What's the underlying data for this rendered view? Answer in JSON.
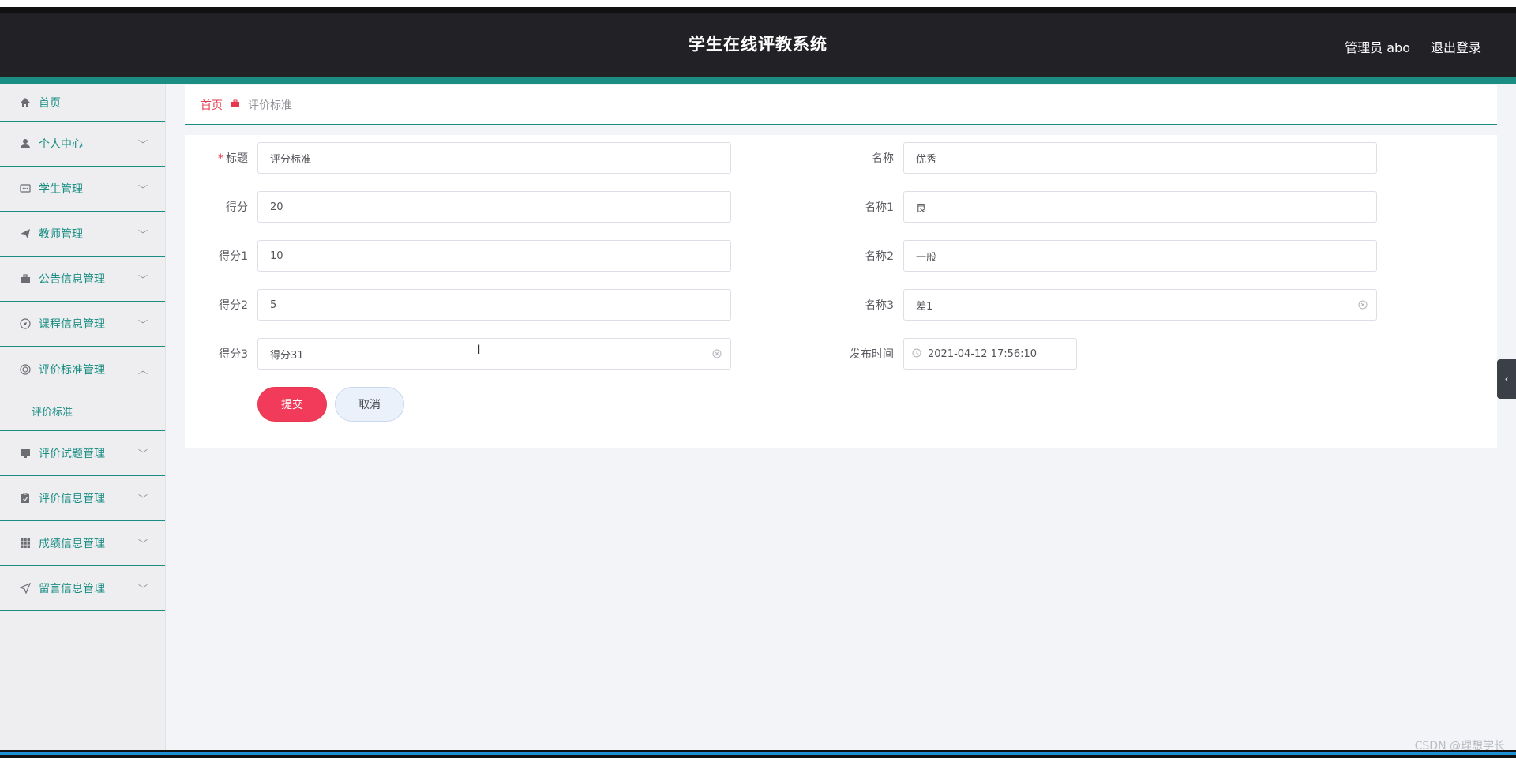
{
  "header": {
    "title": "学生在线评教系统",
    "user": "管理员 abo",
    "logout": "退出登录"
  },
  "sidebar": {
    "items": [
      {
        "label": "首页",
        "icon": "home-icon"
      },
      {
        "label": "个人中心",
        "icon": "user-icon"
      },
      {
        "label": "学生管理",
        "icon": "chat-icon"
      },
      {
        "label": "教师管理",
        "icon": "send-icon"
      },
      {
        "label": "公告信息管理",
        "icon": "briefcase-icon"
      },
      {
        "label": "课程信息管理",
        "icon": "compass-icon"
      },
      {
        "label": "评价标准管理",
        "icon": "circle-icon"
      },
      {
        "label": "评价试题管理",
        "icon": "monitor-icon"
      },
      {
        "label": "评价信息管理",
        "icon": "clipboard-icon"
      },
      {
        "label": "成绩信息管理",
        "icon": "grid-icon"
      },
      {
        "label": "留言信息管理",
        "icon": "navigation-icon"
      }
    ],
    "submenu": "评价标准"
  },
  "breadcrumb": {
    "home": "首页",
    "current": "评价标准"
  },
  "form": {
    "title_label": "标题",
    "title_value": "评分标准",
    "score_label": "得分",
    "score_value": "20",
    "score1_label": "得分1",
    "score1_value": "10",
    "score2_label": "得分2",
    "score2_value": "5",
    "score3_label": "得分3",
    "score3_value": "得分31",
    "name_label": "名称",
    "name_value": "优秀",
    "name1_label": "名称1",
    "name1_value": "良",
    "name2_label": "名称2",
    "name2_value": "一般",
    "name3_label": "名称3",
    "name3_value": "差1",
    "publish_label": "发布时间",
    "publish_value": "2021-04-12 17:56:10"
  },
  "buttons": {
    "submit": "提交",
    "cancel": "取消"
  },
  "watermark": "CSDN @理想学长",
  "colors": {
    "accent": "#1b8e84",
    "danger": "#f23b5a",
    "header_bg": "#222125"
  }
}
